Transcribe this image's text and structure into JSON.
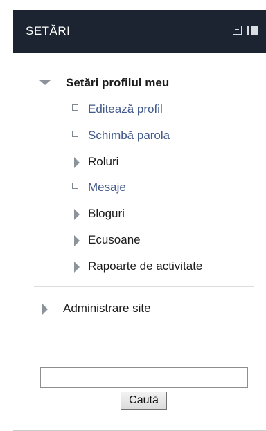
{
  "block": {
    "title": "SETĂRI"
  },
  "profile_section": {
    "label": "Setări profilul meu",
    "items": [
      {
        "label": "Editează profil"
      },
      {
        "label": "Schimbă parola"
      },
      {
        "label": "Roluri"
      },
      {
        "label": "Mesaje"
      },
      {
        "label": "Bloguri"
      },
      {
        "label": "Ecusoane"
      },
      {
        "label": "Rapoarte de activitate"
      }
    ]
  },
  "admin_section": {
    "label": "Administrare site"
  },
  "search": {
    "value": "",
    "button_label": "Caută"
  },
  "icons": {
    "collapse": "minus-box-icon",
    "dock": "dock-icon",
    "expanded": "triangle-down-icon",
    "collapsed": "triangle-right-icon",
    "leaf": "square-bullet-icon"
  },
  "colors": {
    "header_bg": "#1c2431",
    "header_text": "#ffffff",
    "link": "#40588a",
    "text": "#1a1a1a",
    "arrow": "#8c939b"
  }
}
